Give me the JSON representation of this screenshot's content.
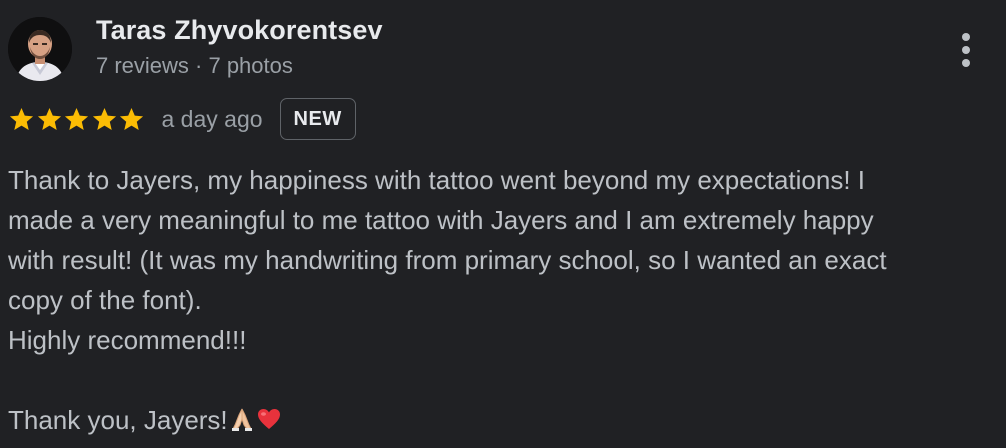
{
  "review": {
    "author": {
      "name": "Taras Zhyvokorentsev",
      "meta": "7 reviews · 7 photos",
      "avatar_icon": "avatar-photo"
    },
    "more_icon": "more-vert-icon",
    "rating": {
      "stars": 5,
      "max_stars": 5,
      "star_color": "#fbbc04"
    },
    "time": "a day ago",
    "badge": "NEW",
    "text_lines": [
      "Thank to Jayers, my happiness with tattoo went beyond my expectations! I",
      "made a very meaningful to me tattoo with Jayers and I am extremely happy",
      "with result! (It was my handwriting from primary school, so I wanted an exact",
      "copy of the font).",
      "Highly recommend!!!",
      "",
      "Thank you, Jayers!"
    ],
    "closing_emojis": [
      "folded-hands-emoji",
      "red-heart-emoji"
    ],
    "colors": {
      "background": "#202124",
      "name": "#e8eaed",
      "text": "#bdc1c6",
      "secondary": "#9aa0a6"
    }
  }
}
